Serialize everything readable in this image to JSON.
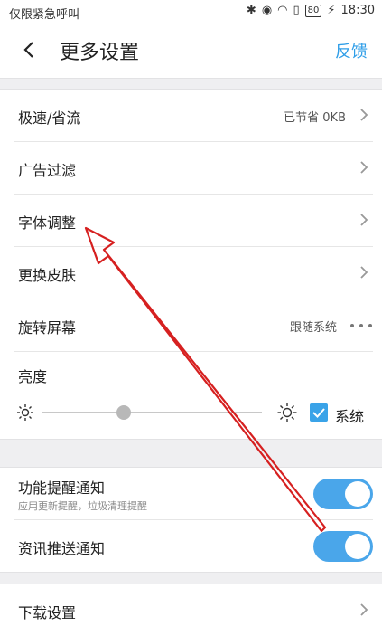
{
  "status_bar": {
    "carrier": "仅限紧急呼叫",
    "battery": "80",
    "time": "18:30"
  },
  "header": {
    "title": "更多设置",
    "feedback": "反馈"
  },
  "group1": {
    "items": [
      {
        "label": "极速/省流",
        "value": "已节省 0KB"
      },
      {
        "label": "广告过滤"
      },
      {
        "label": "字体调整"
      },
      {
        "label": "更换皮肤"
      },
      {
        "label": "旋转屏幕",
        "value": "跟随系统"
      }
    ],
    "brightness": {
      "label": "亮度",
      "level": 0.37,
      "system_label": "系统",
      "system_checked": true
    }
  },
  "group2": {
    "items": [
      {
        "label": "功能提醒通知",
        "sub": "应用更新提醒，垃圾清理提醒",
        "enabled": true
      },
      {
        "label": "资讯推送通知",
        "enabled": true
      }
    ]
  },
  "group3": {
    "items": [
      {
        "label": "下载设置"
      }
    ]
  },
  "annotation": {
    "color": "#d62020"
  }
}
